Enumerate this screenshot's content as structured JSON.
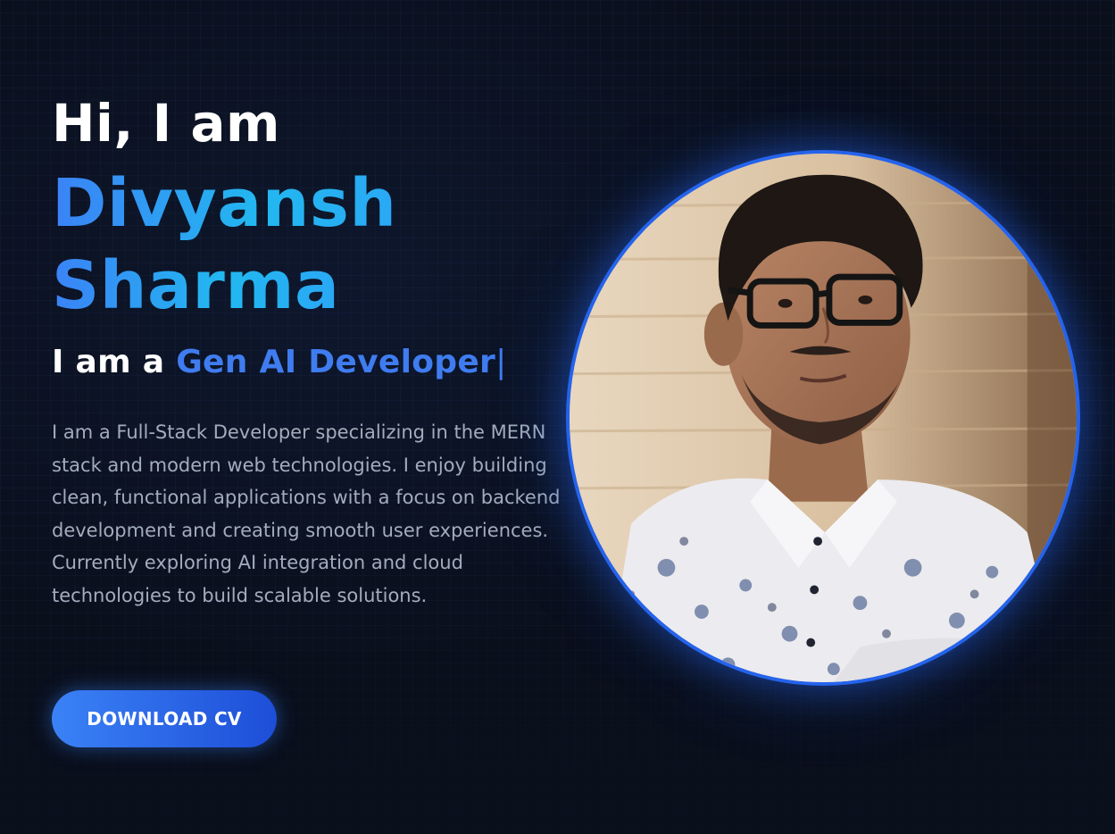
{
  "hero": {
    "greeting": "Hi, I am",
    "name_first": "Divyansh",
    "name_last": "Sharma",
    "role_prefix": "I am a ",
    "role_highlight": "Gen AI Developer",
    "role_cursor": "|",
    "intro": "I am a Full-Stack Developer specializing in the MERN stack and modern web technologies. I enjoy building clean, functional applications with a focus on backend development and creating smooth user experiences. Currently exploring AI integration and cloud technologies to build scalable solutions.",
    "cta_label": "DOWNLOAD CV"
  },
  "profile_photo": {
    "subject": "portrait-photo"
  },
  "theme": {
    "background": "#0a0f1c",
    "accent": "#3b82f6",
    "accent_dark": "#1d4ed8",
    "name_gradient_end": "#22b8f0",
    "body_text": "#a3acbd",
    "heading_text": "#ffffff"
  }
}
